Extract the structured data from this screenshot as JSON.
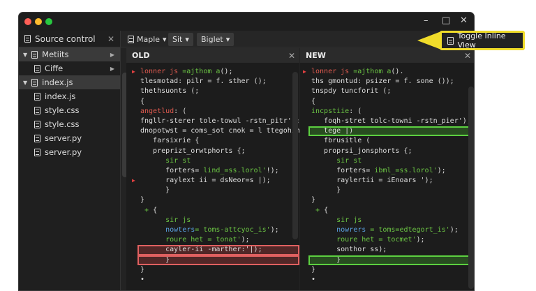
{
  "sidebar": {
    "title": "Source control",
    "items": [
      {
        "label": "Metiits",
        "expanded": true,
        "selected": true,
        "arrow": true
      },
      {
        "label": "Ciffe",
        "expanded": false,
        "selected": false,
        "arrow": true
      },
      {
        "label": "index.js",
        "expanded": true,
        "selected": true,
        "arrow": false
      },
      {
        "label": "index.js"
      },
      {
        "label": "style.css"
      },
      {
        "label": "style.css"
      },
      {
        "label": "server.py"
      },
      {
        "label": "server.py"
      }
    ]
  },
  "toolbar": {
    "branch": "Maple",
    "btn1": "Sit",
    "btn2": "Biglet"
  },
  "tooltip": {
    "label": "Toggle Inline View"
  },
  "panes": {
    "old": {
      "title": "OLD"
    },
    "new": {
      "title": "NEW"
    }
  },
  "old_lines": [
    {
      "m": "▶",
      "s": [
        [
          "r",
          "lonner js "
        ],
        [
          "g",
          "=ajthom a"
        ],
        [
          "w",
          "();"
        ]
      ]
    },
    {
      "i": 0,
      "s": [
        [
          "w",
          "tlesmotad: pilr = f. sther ();"
        ]
      ]
    },
    {
      "s": [
        [
          "w",
          "thethsuonts (;"
        ]
      ]
    },
    {
      "s": [
        [
          "w",
          "{"
        ]
      ]
    },
    {
      "s": [
        [
          "r",
          "angetlud"
        ],
        [
          "w",
          ": ("
        ]
      ]
    },
    {
      "s": [
        [
          "w",
          "fngllr-sterer tole-towul -rstn_pitr');"
        ]
      ]
    },
    {
      "s": [
        [
          "w",
          "dnopotwst = coms_sot cnok = l ttegohin !)"
        ]
      ]
    },
    {
      "s": [
        [
          "w",
          "   farsixrie {"
        ]
      ]
    },
    {
      "s": [
        [
          "w",
          "   preprizt_orwtphorts {;"
        ]
      ]
    },
    {
      "s": [
        [
          "g",
          "      sir st"
        ]
      ]
    },
    {
      "s": [
        [
          "w",
          "      forters= "
        ],
        [
          "g",
          "lind_=ss.lorol'"
        ],
        [
          "w",
          "!);"
        ]
      ]
    },
    {
      "m": "▶",
      "s": [
        [
          "w",
          "      raylext ii = dsNeor=s |);"
        ]
      ]
    },
    {
      "s": [
        [
          "w",
          "      }"
        ]
      ]
    },
    {
      "s": [
        [
          "w",
          "}"
        ]
      ]
    },
    {
      "s": [
        [
          "g",
          " + "
        ],
        [
          "w",
          "{"
        ]
      ]
    },
    {
      "s": [
        [
          "g",
          "      sir js"
        ]
      ]
    },
    {
      "s": [
        [
          "b",
          "      nowters"
        ],
        [
          "g",
          "= toms-attcyoc_is'"
        ],
        [
          "w",
          ");"
        ]
      ]
    },
    {
      "s": [
        [
          "g",
          "      roure het = tonat'"
        ],
        [
          "w",
          ");"
        ]
      ]
    },
    {
      "h": "red",
      "s": [
        [
          "w",
          "      cayler-ii -marther:'|);"
        ]
      ]
    },
    {
      "h": "red",
      "s": [
        [
          "w",
          "      }"
        ]
      ]
    },
    {
      "s": [
        [
          "w",
          "}"
        ]
      ]
    },
    {
      "s": [
        [
          "w",
          "•"
        ]
      ]
    }
  ],
  "new_lines": [
    {
      "m": "▶",
      "s": [
        [
          "r",
          "lonner js "
        ],
        [
          "g",
          "=ajthom a"
        ],
        [
          "w",
          "()."
        ]
      ]
    },
    {
      "s": [
        [
          "w",
          "ths gmontud: psizer = f. sone ());"
        ]
      ]
    },
    {
      "s": [
        [
          "w",
          "tnspdy tuncforit (;"
        ]
      ]
    },
    {
      "s": [
        [
          "w",
          "{"
        ]
      ]
    },
    {
      "s": [
        [
          "g",
          "incpstiie"
        ],
        [
          "w",
          ": ("
        ]
      ]
    },
    {
      "s": [
        [
          "w",
          "   foqh-stret tolc-towni -rstn_pier');"
        ]
      ]
    },
    {
      "h": "green",
      "s": [
        [
          "w",
          "   tege |)"
        ]
      ]
    },
    {
      "s": [
        [
          "w",
          "   fbrusitle ("
        ]
      ]
    },
    {
      "s": [
        [
          "w",
          "   proprsi_jonsphorts {;"
        ]
      ]
    },
    {
      "s": [
        [
          "g",
          "      sir st"
        ]
      ]
    },
    {
      "s": [
        [
          "w",
          "      forters= "
        ],
        [
          "g",
          "ibml_=ss.lorol'"
        ],
        [
          "w",
          ");"
        ]
      ]
    },
    {
      "s": [
        [
          "w",
          "      raylertii = iEnoars ');"
        ]
      ]
    },
    {
      "s": [
        [
          "w",
          "      }"
        ]
      ]
    },
    {
      "s": [
        [
          "w",
          "}"
        ]
      ]
    },
    {
      "s": [
        [
          "g",
          " + "
        ],
        [
          "w",
          "{"
        ]
      ]
    },
    {
      "s": [
        [
          "g",
          "      sir js"
        ]
      ]
    },
    {
      "s": [
        [
          "b",
          "      nowrers"
        ],
        [
          "g",
          " = toms=edtegort_is'"
        ],
        [
          "w",
          ");"
        ]
      ]
    },
    {
      "s": [
        [
          "g",
          "      roure het = tocmet'"
        ],
        [
          "w",
          ");"
        ]
      ]
    },
    {
      "s": [
        [
          "w",
          "      sonthor ss);"
        ]
      ]
    },
    {
      "h": "green",
      "s": [
        [
          "w",
          "      }"
        ]
      ]
    },
    {
      "s": [
        [
          "w",
          "}"
        ]
      ]
    },
    {
      "s": [
        [
          "w",
          "•"
        ]
      ]
    }
  ],
  "colors": {
    "accent": "#f0dc2a",
    "added": "#5cd040",
    "removed": "#e06060"
  }
}
